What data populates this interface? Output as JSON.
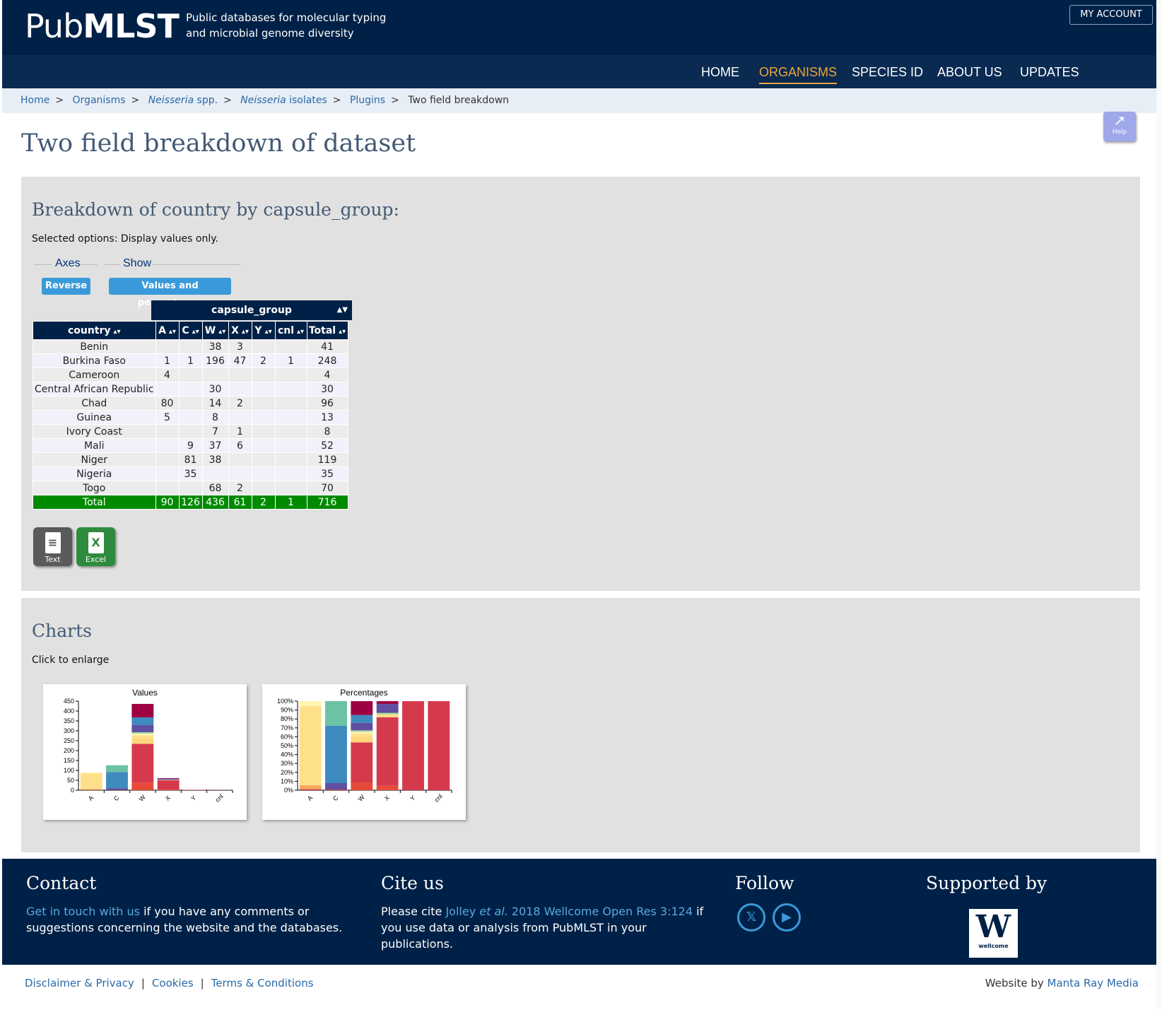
{
  "header": {
    "logo_light": "Pub",
    "logo_bold": "MLST",
    "tagline_1": "Public databases for molecular typing",
    "tagline_2": "and microbial genome diversity",
    "account": "MY ACCOUNT"
  },
  "nav": [
    "HOME",
    "ORGANISMS",
    "SPECIES ID",
    "ABOUT US",
    "UPDATES"
  ],
  "nav_active": "ORGANISMS",
  "accent_color": "#f0a53a",
  "breadcrumb": {
    "home": "Home",
    "organisms": "Organisms",
    "neisseria_italic": "Neisseria",
    "neisseria_rest": " spp.",
    "isolates_italic": "Neisseria",
    "isolates_rest": " isolates",
    "plugins": "Plugins",
    "current": "Two field breakdown"
  },
  "help_label": "Help",
  "page_title": "Two field breakdown of dataset",
  "breakdown": {
    "heading": "Breakdown of country by capsule_group:",
    "selected_options": "Selected options: Display values only.",
    "axes_label": "Axes",
    "show_label": "Show",
    "reverse_btn": "Reverse",
    "values_btn": "Values and percentages",
    "group_header": "capsule_group",
    "columns": [
      "country",
      "A",
      "C",
      "W",
      "X",
      "Y",
      "cnl",
      "Total"
    ],
    "rows": [
      [
        "Benin",
        "",
        "",
        "38",
        "3",
        "",
        "",
        "41"
      ],
      [
        "Burkina Faso",
        "1",
        "1",
        "196",
        "47",
        "2",
        "1",
        "248"
      ],
      [
        "Cameroon",
        "4",
        "",
        "",
        "",
        "",
        "",
        "4"
      ],
      [
        "Central African Republic",
        "",
        "",
        "30",
        "",
        "",
        "",
        "30"
      ],
      [
        "Chad",
        "80",
        "",
        "14",
        "2",
        "",
        "",
        "96"
      ],
      [
        "Guinea",
        "5",
        "",
        "8",
        "",
        "",
        "",
        "13"
      ],
      [
        "Ivory Coast",
        "",
        "",
        "7",
        "1",
        "",
        "",
        "8"
      ],
      [
        "Mali",
        "",
        "9",
        "37",
        "6",
        "",
        "",
        "52"
      ],
      [
        "Niger",
        "",
        "81",
        "38",
        "",
        "",
        "",
        "119"
      ],
      [
        "Nigeria",
        "",
        "35",
        "",
        "",
        "",
        "",
        "35"
      ],
      [
        "Togo",
        "",
        "",
        "68",
        "2",
        "",
        "",
        "70"
      ]
    ],
    "total_row": [
      "Total",
      "90",
      "126",
      "436",
      "61",
      "2",
      "1",
      "716"
    ],
    "export_text": "Text",
    "export_excel": "Excel"
  },
  "charts": {
    "heading": "Charts",
    "note": "Click to enlarge"
  },
  "chart_data": [
    {
      "type": "bar",
      "stacked": true,
      "title": "Values",
      "categories": [
        "A",
        "C",
        "W",
        "X",
        "Y",
        "cnl"
      ],
      "ylim": [
        0,
        450
      ],
      "yticks": [
        0,
        50,
        100,
        150,
        200,
        250,
        300,
        350,
        400,
        450
      ],
      "series": [
        {
          "values": [
            0,
            0,
            38,
            3,
            0,
            0
          ],
          "color": "#e84a3a"
        },
        {
          "values": [
            1,
            1,
            196,
            47,
            2,
            1
          ],
          "color": "#d53a4c"
        },
        {
          "values": [
            4,
            0,
            0,
            0,
            0,
            0
          ],
          "color": "#f7a85c"
        },
        {
          "values": [
            0,
            0,
            30,
            0,
            0,
            0
          ],
          "color": "#fdd77c"
        },
        {
          "values": [
            80,
            0,
            14,
            2,
            0,
            0
          ],
          "color": "#fee08b"
        },
        {
          "values": [
            5,
            0,
            8,
            0,
            0,
            0
          ],
          "color": "#fff6b0"
        },
        {
          "values": [
            0,
            0,
            7,
            1,
            0,
            0
          ],
          "color": "#a3d49c"
        },
        {
          "values": [
            0,
            9,
            37,
            6,
            0,
            0
          ],
          "color": "#5e4fa2"
        },
        {
          "values": [
            0,
            81,
            38,
            0,
            0,
            0
          ],
          "color": "#3f8bbf"
        },
        {
          "values": [
            0,
            35,
            0,
            0,
            0,
            0
          ],
          "color": "#6cc2a4"
        },
        {
          "values": [
            0,
            0,
            68,
            2,
            0,
            0
          ],
          "color": "#9e0142"
        }
      ]
    },
    {
      "type": "bar",
      "stacked": true,
      "title": "Percentages",
      "categories": [
        "A",
        "C",
        "W",
        "X",
        "Y",
        "cnl"
      ],
      "ylim": [
        0,
        100
      ],
      "yticks": [
        "0%",
        "10%",
        "20%",
        "30%",
        "40%",
        "50%",
        "60%",
        "70%",
        "80%",
        "90%",
        "100%"
      ]
    }
  ],
  "footer": {
    "contact_title": "Contact",
    "contact_link": "Get in touch with us",
    "contact_text": " if you have any comments or suggestions concerning the website and the databases.",
    "cite_title": "Cite us",
    "cite_pre": "Please cite ",
    "cite_link_a": "Jolley ",
    "cite_link_i": "et al.",
    "cite_link_b": " 2018 Wellcome Open Res 3:124",
    "cite_post": " if you use data or analysis from PubMLST in your publications.",
    "follow_title": "Follow",
    "supported_title": "Supported by",
    "wellcome_text": "wellcome"
  },
  "bottom": {
    "disclaimer": "Disclaimer & Privacy",
    "cookies": "Cookies",
    "terms": "Terms & Conditions",
    "website_by": "Website by ",
    "manta": "Manta Ray Media"
  }
}
